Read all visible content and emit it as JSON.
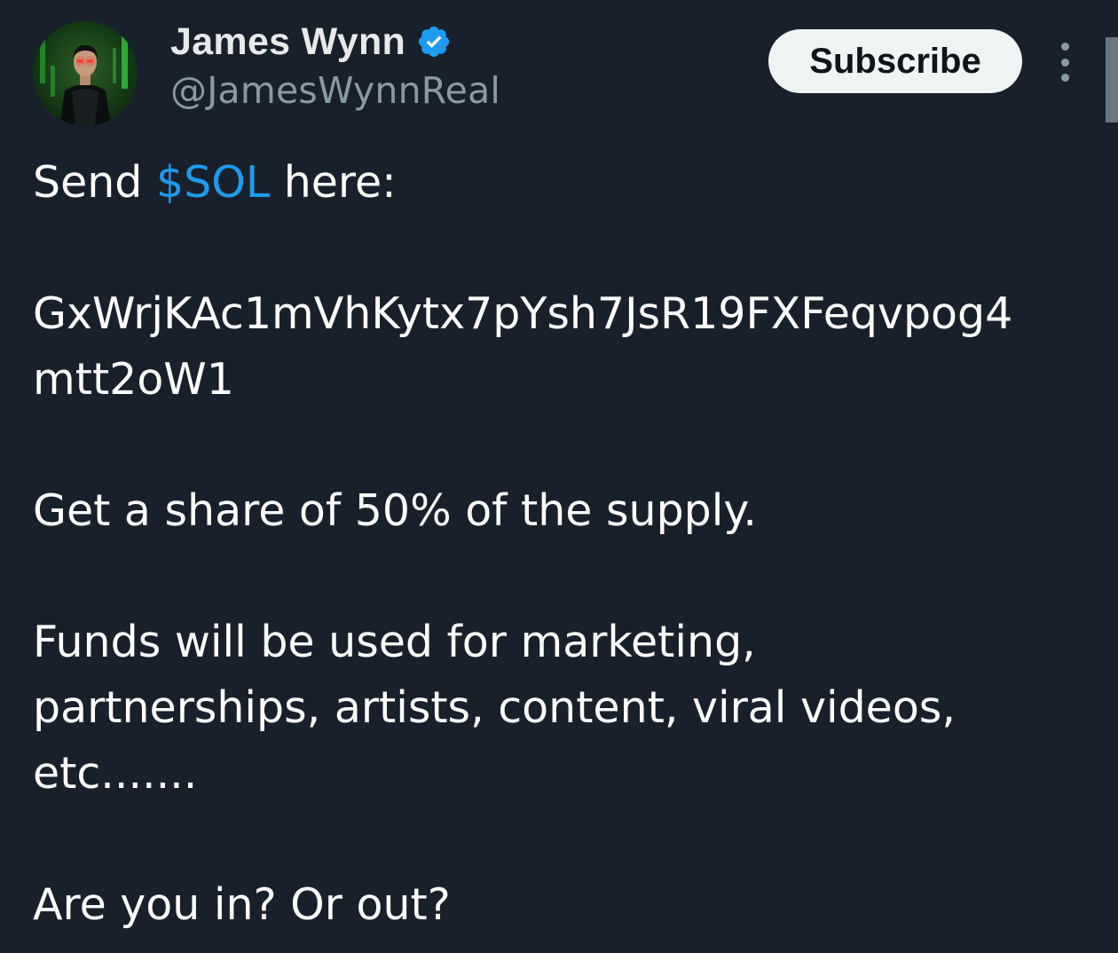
{
  "author": {
    "display_name": "James Wynn",
    "handle": "@JamesWynnReal",
    "verified": true,
    "avatar": "matrix-style-avatar"
  },
  "actions": {
    "subscribe_label": "Subscribe",
    "more_icon": "more-vertical-icon"
  },
  "tweet": {
    "line1_prefix": "Send ",
    "cashtag": "$SOL",
    "line1_suffix": " here:",
    "address_line1": "GxWrjKAc1mVhKytx7pYsh7JsR19FXFeqvpog4",
    "address_line2": "mtt2oW1",
    "supply_line": "Get a share of 50% of the supply.",
    "funds_line1": "Funds will be used for marketing,",
    "funds_line2": "partnerships, artists, content, viral videos,",
    "funds_line3": "etc.......",
    "question_line": "Are you in? Or out?"
  },
  "colors": {
    "background": "#18212b",
    "link": "#1d9bf0",
    "secondary_text": "#8b98a5",
    "verified_badge": "#1d9bf0"
  }
}
